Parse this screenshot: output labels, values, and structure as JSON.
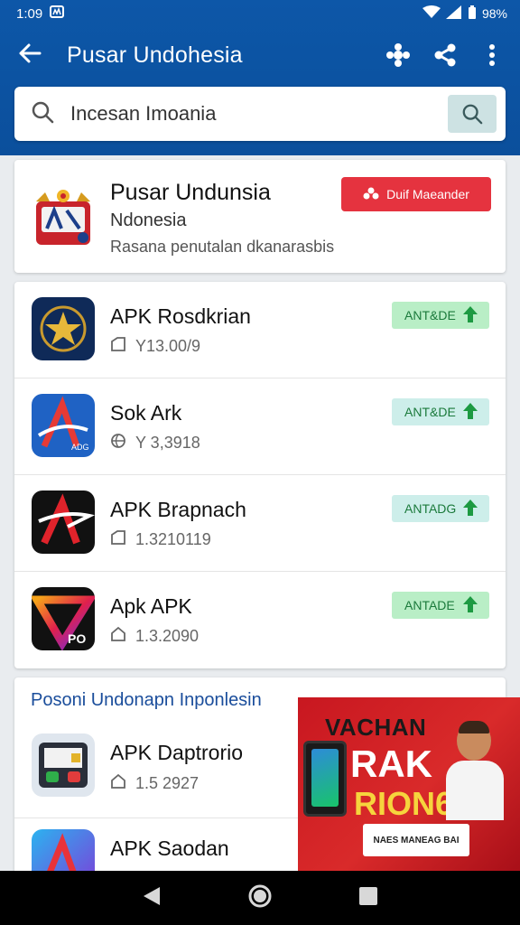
{
  "status": {
    "time": "1:09",
    "battery": "98%"
  },
  "appbar": {
    "title": "Pusar Undohesia"
  },
  "search": {
    "value": "Incesan Imoania"
  },
  "featured": {
    "name": "Pusar Undunsia",
    "subtitle": "Ndonesia",
    "description": "Rasana penutalan dkanarasbis",
    "cta_label": "Duif Maeander",
    "cta_color": "#e5333f"
  },
  "apps": [
    {
      "name": "APK Rosdkrian",
      "meta": "Y13.00/9",
      "download_label": "ANT&DE",
      "icon": "star-emblem-icon"
    },
    {
      "name": "Sok Ark",
      "meta": "Y 3,3918",
      "download_label": "ANT&DE",
      "icon": "a-logo-blue-icon"
    },
    {
      "name": "APK Brapnach",
      "meta": "1.3210119",
      "download_label": "ANTADG",
      "icon": "a-logo-black-icon"
    },
    {
      "name": "Apk APK",
      "meta": "1.3.2090",
      "download_label": "ANTADE",
      "icon": "v-logo-icon"
    }
  ],
  "section": {
    "title": "Posoni Undonapn Inponlesin",
    "apps": [
      {
        "name": "APK Daptrorio",
        "meta": "1.5 2927",
        "icon": "game-icon"
      },
      {
        "name": "APK Saodan",
        "icon": "a-logo-gradient-icon"
      }
    ]
  },
  "banner": {
    "line1": "VACHAN",
    "line2": "RAK",
    "line3": "RION6",
    "tag": "NAES MANEAG BAI"
  },
  "colors": {
    "header": "#0d57a8",
    "download_bg": "#c8f0d0",
    "accent_red": "#e5333f"
  }
}
